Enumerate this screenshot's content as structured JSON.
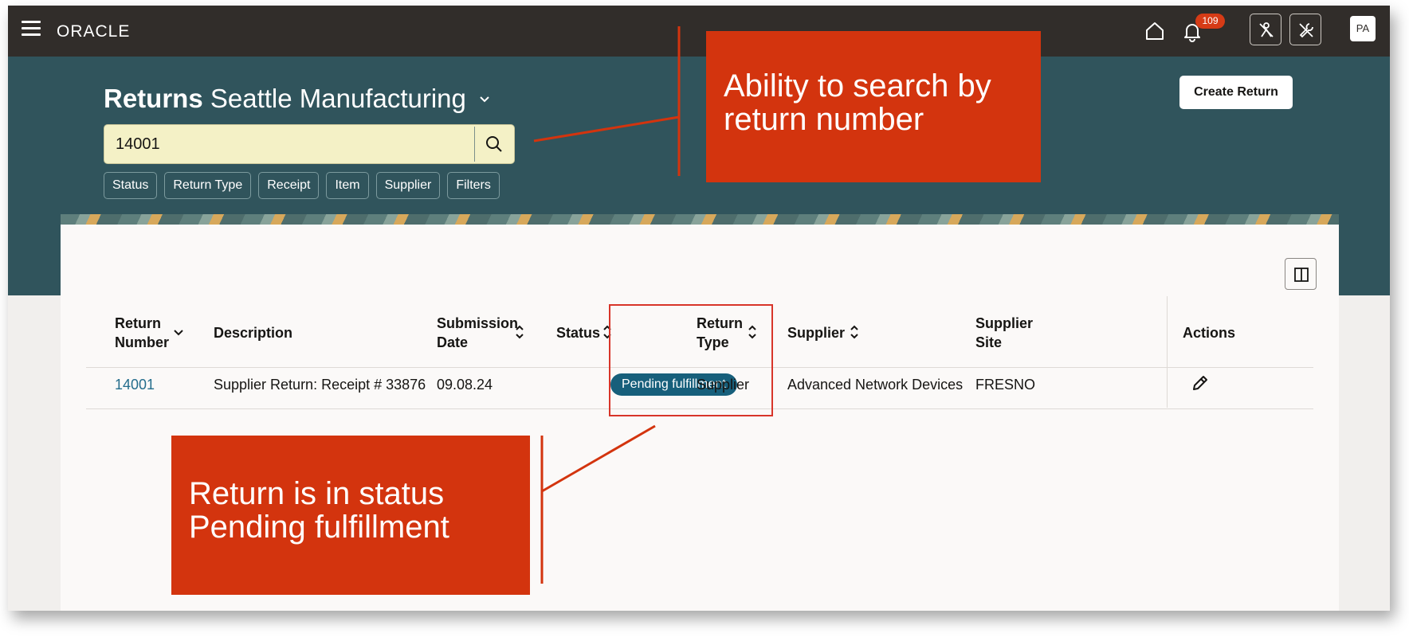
{
  "header": {
    "logo": "ORACLE",
    "notification_count": "109",
    "avatar_initials": "PA"
  },
  "page": {
    "title_bold": "Returns",
    "title_context": "Seattle Manufacturing",
    "create_button": "Create Return"
  },
  "search": {
    "value": "14001"
  },
  "filters": [
    "Status",
    "Return Type",
    "Receipt",
    "Item",
    "Supplier",
    "Filters"
  ],
  "table": {
    "columns": {
      "return_number_l1": "Return",
      "return_number_l2": "Number",
      "description": "Description",
      "submission_date_l1": "Submission",
      "submission_date_l2": "Date",
      "status": "Status",
      "return_type_l1": "Return",
      "return_type_l2": "Type",
      "supplier": "Supplier",
      "supplier_site_l1": "Supplier",
      "supplier_site_l2": "Site",
      "actions": "Actions"
    },
    "rows": [
      {
        "return_number": "14001",
        "description": "Supplier Return: Receipt # 33876",
        "submission_date": "09.08.24",
        "status": "Pending fulfillment",
        "return_type": "Supplier",
        "supplier": "Advanced Network Devices",
        "supplier_site": "FRESNO"
      }
    ]
  },
  "annotations": {
    "callout_search": "Ability to search by return number",
    "callout_status": "Return is in status Pending fulfillment",
    "callout_color": "#d3340e"
  },
  "colors": {
    "topbar": "#312d2a",
    "hero": "#30545c",
    "status_pill": "#175f7b",
    "link": "#246d8c"
  }
}
